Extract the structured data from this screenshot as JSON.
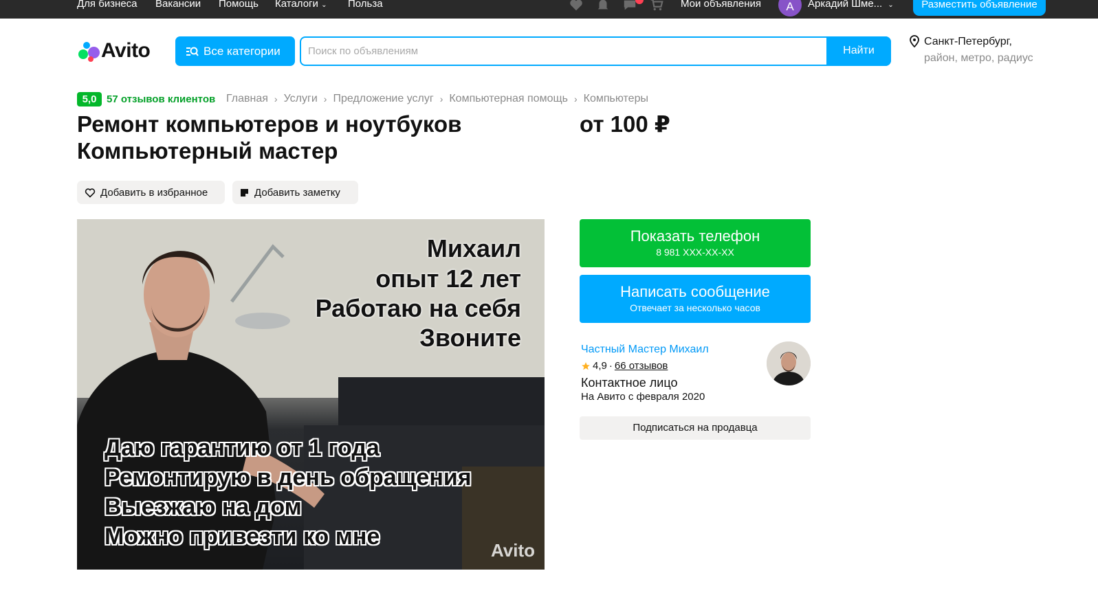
{
  "topbar": {
    "links": [
      "Для бизнеса",
      "Вакансии",
      "Помощь",
      "Каталоги",
      "Польза"
    ],
    "my_ads": "Мои объявления",
    "user_initial": "А",
    "user_name": "Аркадий Шме...",
    "post_ad": "Разместить объявление",
    "icons": [
      "heart-icon",
      "bell-icon",
      "chat-icon",
      "cart-icon"
    ]
  },
  "header": {
    "logo": "Avito",
    "categories_button": "Все категории",
    "search_placeholder": "Поиск по объявлениям",
    "search_value": "",
    "search_button": "Найти",
    "location_line1": "Санкт-Петербург,",
    "location_line2": "район, метро, радиус"
  },
  "listing": {
    "rating": "5,0",
    "reviews": "57 отзывов клиентов",
    "breadcrumbs": [
      "Главная",
      "Услуги",
      "Предложение услуг",
      "Компьютерная помощь",
      "Компьютеры"
    ],
    "title_line1": "Ремонт компьютеров и ноутбуков",
    "title_line2": "Компьютерный мастер",
    "price": "от 100 ₽",
    "add_favorite": "Добавить в избранное",
    "add_note": "Добавить заметку"
  },
  "photo": {
    "top_lines": [
      "Михаил",
      "опыт 12 лет",
      "Работаю на себя",
      "Звоните"
    ],
    "bottom_lines": [
      "Даю гарантию от 1 года",
      "Ремонтирую в день обращения",
      "Выезжаю на дом",
      "Можно привезти ко мне"
    ],
    "watermark": "Avito"
  },
  "contact": {
    "phone_button": "Показать телефон",
    "phone_masked": "8 981 XXX-XX-XX",
    "message_button": "Написать сообщение",
    "message_sub": "Отвечает за несколько часов"
  },
  "seller": {
    "name": "Частный Мастер Михаил",
    "rating": "4,9",
    "dot": "·",
    "reviews": "66 отзывов",
    "role": "Контактное лицо",
    "since": "На Авито с февраля 2020",
    "subscribe": "Подписаться на продавца"
  },
  "colors": {
    "accent_blue": "#00aaff",
    "green": "#03c037",
    "rating_green": "#03b72a",
    "topbar": "#2a2a2a"
  }
}
